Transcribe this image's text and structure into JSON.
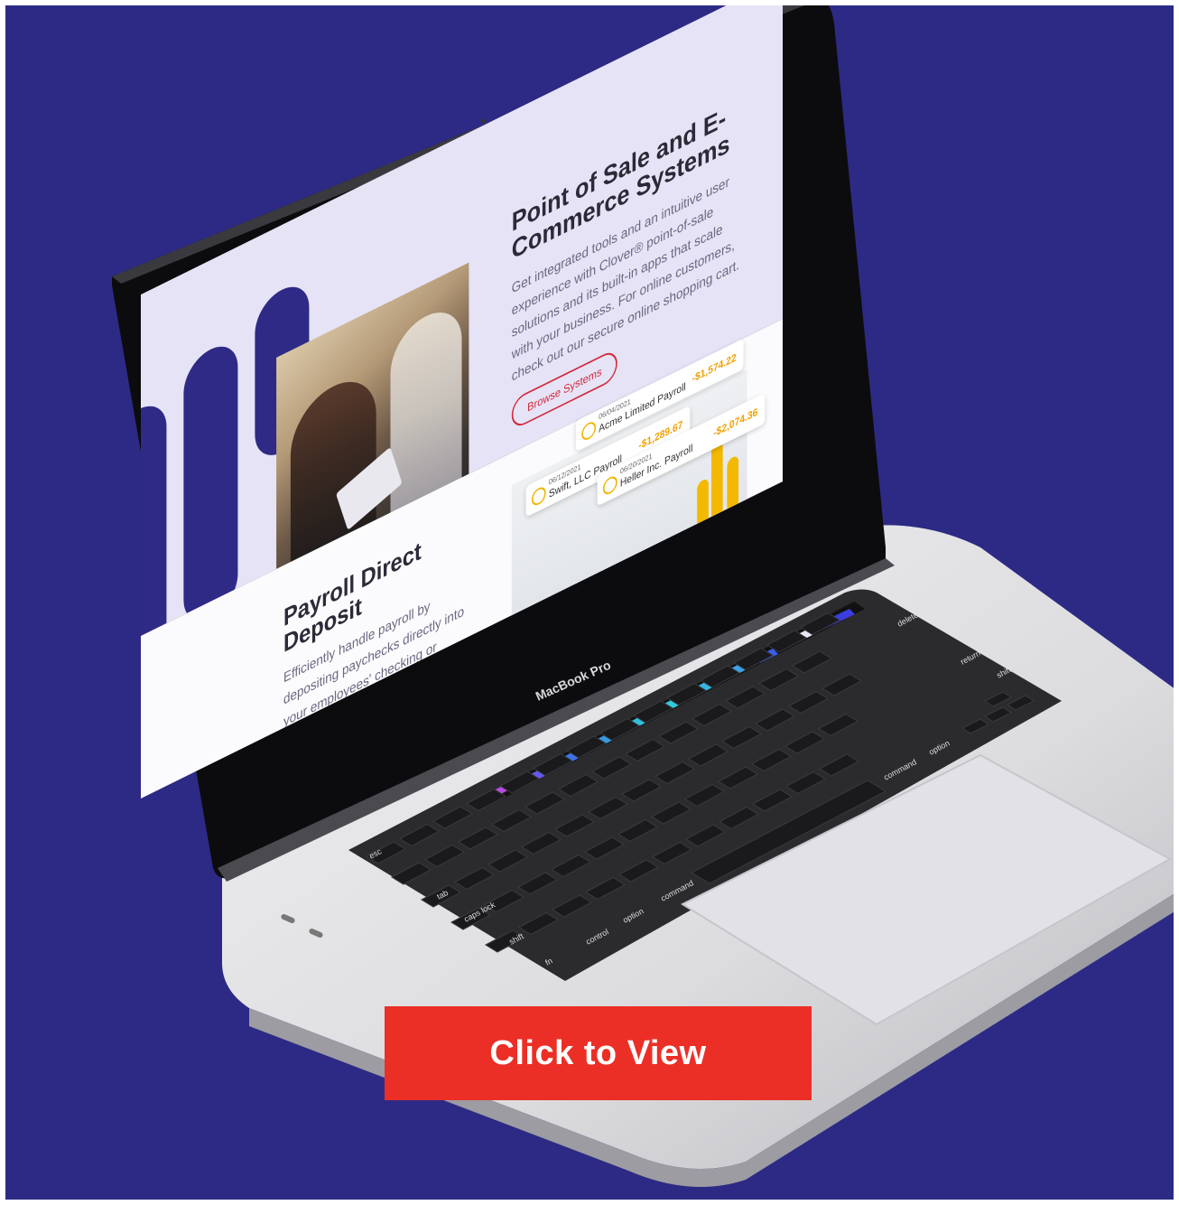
{
  "colors": {
    "background": "#2d2a85",
    "cta": "#ec2f26",
    "accent_red": "#d2293a",
    "amount": "#f0a000"
  },
  "screen": {
    "pos_section": {
      "title": "Point of Sale and E-Commerce Systems",
      "body": "Get integrated tools and an intuitive user experience with Clover® point-of-sale solutions and its built-in apps that scale with your business. For online customers, check out our secure online shopping cart.",
      "button_label": "Browse Systems"
    },
    "payroll_section": {
      "title": "Payroll Direct Deposit",
      "body": "Efficiently handle payroll by depositing paychecks directly into your employees' checking or savings accounts. Plus, use direct deposit"
    },
    "payroll_cards": [
      {
        "date": "06/04/2021",
        "name": "Acme Limited Payroll",
        "amount": "-$1,574.22"
      },
      {
        "date": "06/12/2021",
        "name": "Swift, LLC Payroll",
        "amount": "-$1,289.67"
      },
      {
        "date": "06/20/2021",
        "name": "Heller Inc. Payroll",
        "amount": "-$2,074.36"
      }
    ]
  },
  "laptop": {
    "brand_label": "MacBook Pro",
    "keys": {
      "esc": "esc",
      "tab": "tab",
      "caps": "caps lock",
      "shift_l": "shift",
      "fn": "fn",
      "control": "control",
      "option_l": "option",
      "command_l": "command",
      "command_r": "command",
      "option_r": "option",
      "delete": "delete",
      "return": "return",
      "shift_r": "shift"
    }
  },
  "cta": {
    "label": "Click to View"
  }
}
